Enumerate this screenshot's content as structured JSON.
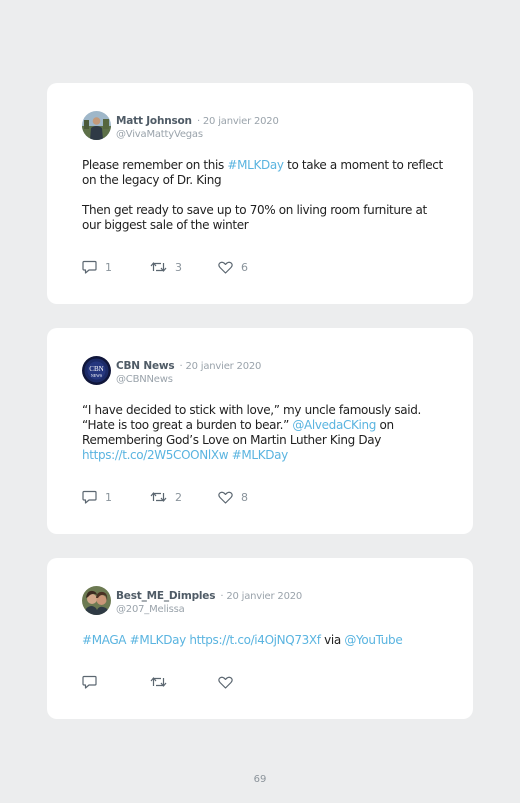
{
  "tweets": [
    {
      "name": "Matt Johnson",
      "date": "· 20 janvier 2020",
      "handle": "@VivaMattyVegas",
      "p1": [
        "Please remember on this ",
        "#MLKDay",
        " to take a moment to reflect on the legacy of Dr. King"
      ],
      "p2": "Then get ready to save up to 70% on living room furniture at our biggest sale of the winter",
      "replies": "1",
      "retweets": "3",
      "likes": "6"
    },
    {
      "name": "CBN News",
      "date": "· 20 janvier 2020",
      "handle": "@CBNNews",
      "avatar_text1": "CBN",
      "avatar_text2": "NEWS",
      "parts": [
        "“I have decided to stick with love,” my uncle famously said. “Hate is too great a burden to bear.” ",
        "@AlvedaCKing",
        " on Remembering God’s Love on Martin Luther King Day ",
        "https://t.co/2W5COONlXw",
        " ",
        "#MLKDay"
      ],
      "replies": "1",
      "retweets": "2",
      "likes": "8"
    },
    {
      "name": "Best_ME_Dimples",
      "date": "· 20 janvier 2020",
      "handle": "@207_Melissa",
      "parts": [
        "#MAGA",
        " ",
        "#MLKDay",
        " ",
        "https://t.co/i4OjNQ73Xf",
        " via ",
        "@YouTube"
      ],
      "replies": "",
      "retweets": "",
      "likes": ""
    }
  ],
  "page_number": "69",
  "colors": {
    "background": "#ecedee",
    "card": "#ffffff",
    "link": "#5ab4e0",
    "meta": "#9aa3ab"
  },
  "icons": {
    "reply": "reply-icon",
    "retweet": "retweet-icon",
    "like": "heart-icon"
  }
}
